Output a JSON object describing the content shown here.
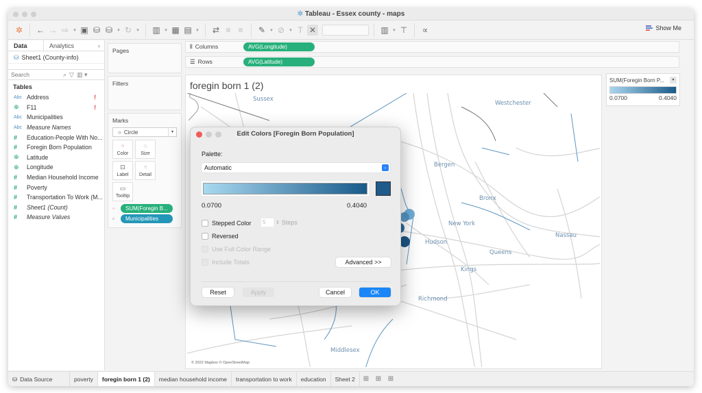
{
  "window": {
    "title": "Tableau - Essex county - maps"
  },
  "toolbar": {
    "show_me_label": "Show Me",
    "icons": [
      "tableau-logo-icon",
      "back-icon",
      "forward-icon",
      "redo-icon",
      "save-icon",
      "new-datasource-icon",
      "pause-updates-icon",
      "refresh-icon",
      "new-worksheet-icon",
      "duplicate-sheet-icon",
      "clear-sheet-icon",
      "swap-icon",
      "sort-ascending-icon",
      "sort-descending-icon",
      "highlight-icon",
      "group-icon",
      "label-icon",
      "pin-icon",
      "fit-dropdown",
      "show-cards-icon",
      "presentation-icon",
      "share-icon"
    ]
  },
  "data_pane": {
    "tabs": {
      "data": "Data",
      "analytics": "Analytics",
      "collapse": "‹"
    },
    "datasource": "Sheet1 (County-info)",
    "search_placeholder": "Search",
    "tables_heading": "Tables",
    "fields": [
      {
        "type": "Abc",
        "name": "Address",
        "warning": "!"
      },
      {
        "type": "globe",
        "name": "F11",
        "warning": "!"
      },
      {
        "type": "Abc",
        "name": "Municipalities"
      },
      {
        "type": "Abc",
        "name": "Measure Names",
        "italic": true
      },
      {
        "type": "#",
        "name": "Education-People With No..."
      },
      {
        "type": "#",
        "name": "Foregin Born Population"
      },
      {
        "type": "globe",
        "name": "Latitude"
      },
      {
        "type": "globe",
        "name": "Longitude"
      },
      {
        "type": "#",
        "name": "Median Household Income"
      },
      {
        "type": "#",
        "name": "Poverty"
      },
      {
        "type": "#",
        "name": "Transportation To Work (M..."
      },
      {
        "type": "#",
        "name": "Sheet1 (Count)",
        "italic": true
      },
      {
        "type": "#",
        "name": "Measure Values",
        "italic": true
      }
    ]
  },
  "cards": {
    "pages": "Pages",
    "filters": "Filters",
    "marks": {
      "title": "Marks",
      "mark_type": "Circle",
      "buttons": [
        "Color",
        "Size",
        "Label",
        "Detail",
        "Tooltip"
      ],
      "pills": [
        "SUM(Foregin B...",
        "Municipalities"
      ]
    }
  },
  "shelves": {
    "columns_label": "Columns",
    "columns_pill": "AVG(Longitude)",
    "rows_label": "Rows",
    "rows_pill": "AVG(Latitude)"
  },
  "viz": {
    "title": "foregin born 1 (2)",
    "map_labels": [
      "Sussex",
      "Westchester",
      "Bergen",
      "Bronx",
      "New York",
      "Nassau",
      "Hudson",
      "Queens",
      "Kings",
      "Richmond",
      "Middlesex"
    ],
    "attribution": "© 2022 Mapbox © OpenStreetMap"
  },
  "legend": {
    "title": "SUM(Foregin Born P...",
    "min": "0.0700",
    "max": "0.4040",
    "color_start": "#aad6ee",
    "color_end": "#1a5a8a"
  },
  "dialog": {
    "title": "Edit Colors [Foregin Born Population]",
    "palette_label": "Palette:",
    "palette_value": "Automatic",
    "range_min": "0.0700",
    "range_max": "0.4040",
    "swatch_color": "#1e5a8a",
    "stepped_color": {
      "label": "Stepped Color",
      "checked": false,
      "steps_value": "5",
      "steps_label": "Steps"
    },
    "reversed": {
      "label": "Reversed",
      "checked": false
    },
    "use_full_range": {
      "label": "Use Full Color Range",
      "enabled": false
    },
    "include_totals": {
      "label": "Include Totals",
      "enabled": false
    },
    "advanced_label": "Advanced >>",
    "reset_label": "Reset",
    "apply_label": "Apply",
    "cancel_label": "Cancel",
    "ok_label": "OK"
  },
  "sheet_tabs": {
    "data_source": "Data Source",
    "tabs": [
      "poverty",
      "foregin born 1 (2)",
      "median household income",
      "transportation to work",
      "education",
      "Sheet 2"
    ],
    "active": "foregin born 1 (2)"
  }
}
